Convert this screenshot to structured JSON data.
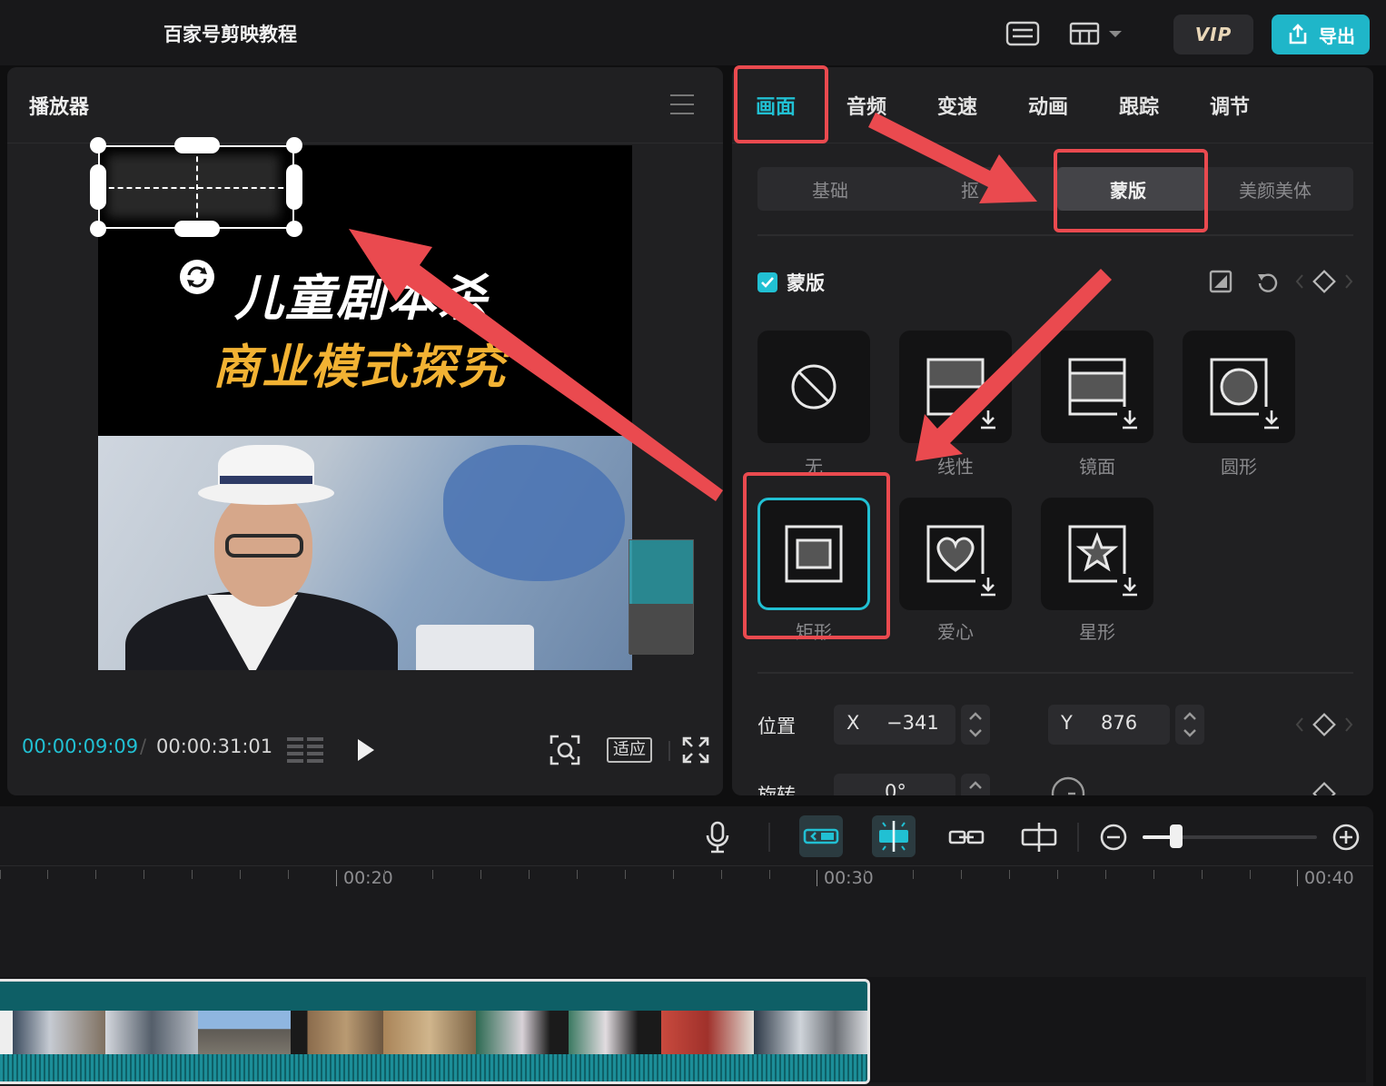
{
  "app": {
    "title": "百家号剪映教程",
    "vip_label": "VIP",
    "export_label": "导出"
  },
  "colors": {
    "accent": "#21c0d3",
    "annotation": "#ea4a4f",
    "export_bg": "#1fb6c9"
  },
  "player": {
    "title": "播放器",
    "overlay_line1": "儿童剧本杀",
    "overlay_line2": "商业模式探究",
    "current_time": "00:00:09:09",
    "separator": "/",
    "total_time": "00:00:31:01",
    "fit_label": "适应"
  },
  "inspector": {
    "tabs": [
      "画面",
      "音频",
      "变速",
      "动画",
      "跟踪",
      "调节"
    ],
    "active_tab": "画面",
    "subtabs": [
      "基础",
      "抠",
      "蒙版",
      "美颜美体"
    ],
    "active_subtab": "蒙版",
    "mask_section_label": "蒙版",
    "mask_enabled": true,
    "shapes": [
      {
        "label": "无",
        "icon": "none-icon"
      },
      {
        "label": "线性",
        "icon": "linear-mask-icon"
      },
      {
        "label": "镜面",
        "icon": "mirror-mask-icon"
      },
      {
        "label": "圆形",
        "icon": "circle-mask-icon"
      },
      {
        "label": "矩形",
        "icon": "rectangle-mask-icon",
        "selected": true
      },
      {
        "label": "爱心",
        "icon": "heart-mask-icon"
      },
      {
        "label": "星形",
        "icon": "star-mask-icon"
      }
    ],
    "position": {
      "label": "位置",
      "x_axis": "X",
      "x_value": "−341",
      "y_axis": "Y",
      "y_value": "876"
    },
    "rotation": {
      "label": "旋转",
      "value": "0°"
    }
  },
  "timeline": {
    "ruler_labels": [
      "00:20",
      "00:30",
      "00:40"
    ]
  }
}
